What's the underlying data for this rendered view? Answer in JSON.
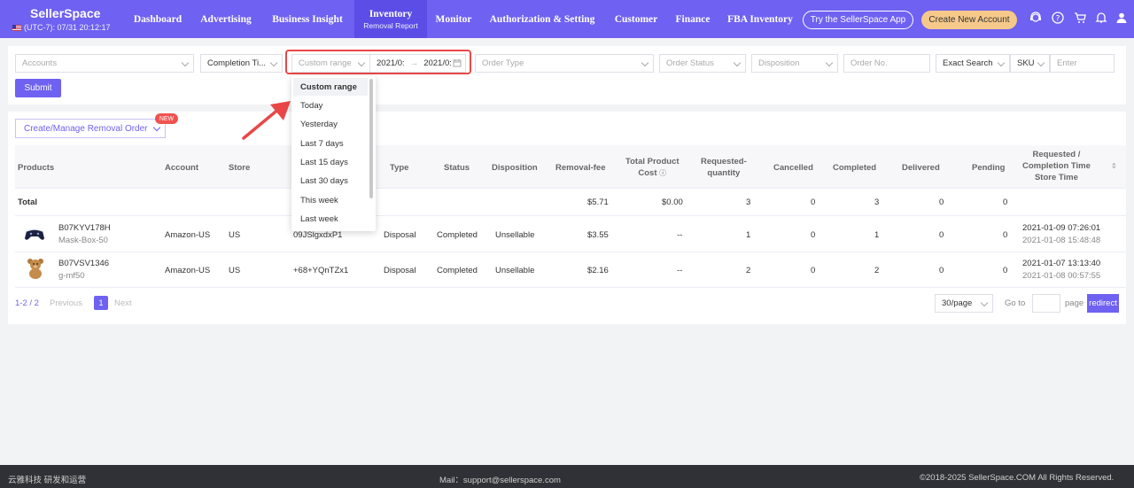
{
  "brand": {
    "name": "SellerSpace",
    "timezone": "(UTC-7): 07/31 20:12:17"
  },
  "nav": {
    "items": [
      "Dashboard",
      "Advertising",
      "Business Insight",
      "Inventory",
      "Monitor",
      "Authorization & Setting",
      "Customer",
      "Finance",
      "FBA Inventory"
    ],
    "active_sub": "Removal Report",
    "app_button": "Try the SellerSpace App",
    "new_account_button": "Create New Account",
    "accent": "#6f61f1"
  },
  "filters": {
    "accounts_placeholder": "Accounts",
    "time_type": "Completion Ti...",
    "range_placeholder": "Custom range",
    "date_start": "2021/0:",
    "date_sep": "→",
    "date_end": "2021/0:",
    "order_type_placeholder": "Order Type",
    "order_status_placeholder": "Order Status",
    "disposition_placeholder": "Disposition",
    "order_no_placeholder": "Order No.",
    "search_mode": "Exact Search",
    "search_field": "SKU",
    "search_placeholder": "Enter",
    "submit": "Submit"
  },
  "dropdown": {
    "items": [
      "Custom range",
      "Today",
      "Yesterday",
      "Last 7 days",
      "Last 15 days",
      "Last 30 days",
      "This week",
      "Last week"
    ]
  },
  "actions": {
    "create_manage": "Create/Manage Removal Order",
    "new_badge": "NEW"
  },
  "table": {
    "headers": {
      "products": "Products",
      "account": "Account",
      "store": "Store",
      "type": "Type",
      "status": "Status",
      "disposition": "Disposition",
      "removal_fee": "Removal-fee",
      "total_cost_1": "Total Product",
      "total_cost_2": "Cost",
      "req_qty_1": "Requested-",
      "req_qty_2": "quantity",
      "cancelled": "Cancelled",
      "completed": "Completed",
      "delivered": "Delivered",
      "pending": "Pending",
      "time_1": "Requested /",
      "time_2": "Completion Time",
      "time_3": "Store Time"
    },
    "total": {
      "label": "Total",
      "removal_fee": "$5.71",
      "total_cost": "$0.00",
      "requested": "3",
      "cancelled": "0",
      "completed": "3",
      "delivered": "0",
      "pending": "0"
    },
    "rows": [
      {
        "asin": "B07KYV178H",
        "sku": "Mask-Box-50",
        "account": "Amazon-US",
        "store": "US",
        "order_id": "09JSlgxdxP1",
        "type": "Disposal",
        "status": "Completed",
        "disposition": "Unsellable",
        "removal_fee": "$3.55",
        "total_cost": "--",
        "requested": "1",
        "cancelled": "0",
        "completed": "1",
        "delivered": "0",
        "pending": "0",
        "requested_time": "2021-01-09 07:26:01",
        "completion_time": "2021-01-08 15:48:48",
        "icon": "gamepad-icon"
      },
      {
        "asin": "B07VSV1346",
        "sku": "g-mf50",
        "account": "Amazon-US",
        "store": "US",
        "order_id": "+68+YQnTZx1",
        "type": "Disposal",
        "status": "Completed",
        "disposition": "Unsellable",
        "removal_fee": "$2.16",
        "total_cost": "--",
        "requested": "2",
        "cancelled": "0",
        "completed": "2",
        "delivered": "0",
        "pending": "0",
        "requested_time": "2021-01-07 13:13:40",
        "completion_time": "2021-01-08 00:57:55",
        "icon": "teddy-bear-icon"
      }
    ]
  },
  "pagination": {
    "range": "1-2 / 2",
    "previous": "Previous",
    "page": "1",
    "next": "Next",
    "per_page": "30/page",
    "goto": "Go to",
    "page_label": "page",
    "redirect": "redirect"
  },
  "footer": {
    "left": "云雅科技 研发和运营",
    "mail": "Mail：support@sellerspace.com",
    "copyright": "©2018-2025 SellerSpace.COM All Rights Reserved."
  }
}
